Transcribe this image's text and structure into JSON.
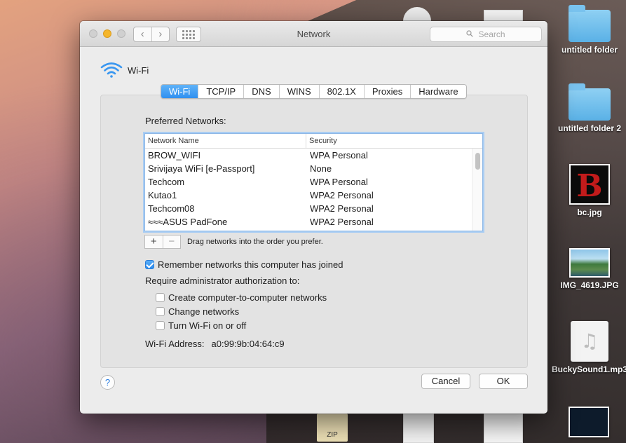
{
  "desktop": {
    "icons": [
      {
        "name": "untitled folder",
        "type": "folder"
      },
      {
        "name": "untitled folder 2",
        "type": "folder"
      },
      {
        "name": "bc.jpg",
        "type": "image"
      },
      {
        "name": "IMG_4619.JPG",
        "type": "image"
      },
      {
        "name": "BuckySound1.mp3",
        "type": "audio"
      }
    ],
    "zip_label": "ZIP"
  },
  "window": {
    "title": "Network",
    "search_placeholder": "Search"
  },
  "header": {
    "title": "Wi-Fi"
  },
  "tabs": [
    {
      "label": "Wi-Fi",
      "active": true
    },
    {
      "label": "TCP/IP",
      "active": false
    },
    {
      "label": "DNS",
      "active": false
    },
    {
      "label": "WINS",
      "active": false
    },
    {
      "label": "802.1X",
      "active": false
    },
    {
      "label": "Proxies",
      "active": false
    },
    {
      "label": "Hardware",
      "active": false
    }
  ],
  "preferred": {
    "label": "Preferred Networks:",
    "columns": {
      "name": "Network Name",
      "security": "Security"
    },
    "rows": [
      {
        "name": "BROW_WIFI",
        "security": "WPA Personal"
      },
      {
        "name": "Srivijaya WiFi [e-Passport]",
        "security": "None"
      },
      {
        "name": "Techcom",
        "security": "WPA Personal"
      },
      {
        "name": "Kutao1",
        "security": "WPA2 Personal"
      },
      {
        "name": "Techcom08",
        "security": "WPA2 Personal"
      },
      {
        "name": "≈≈≈ASUS PadFone",
        "security": "WPA2 Personal"
      }
    ],
    "add": "+",
    "remove": "−",
    "drag_hint": "Drag networks into the order you prefer."
  },
  "options": {
    "remember": {
      "label": "Remember networks this computer has joined",
      "checked": true
    },
    "require_label": "Require administrator authorization to:",
    "admin": [
      {
        "label": "Create computer-to-computer networks",
        "checked": false
      },
      {
        "label": "Change networks",
        "checked": false
      },
      {
        "label": "Turn Wi-Fi on or off",
        "checked": false
      }
    ]
  },
  "address": {
    "label": "Wi-Fi Address:",
    "value": "a0:99:9b:04:64:c9"
  },
  "buttons": {
    "help": "?",
    "cancel": "Cancel",
    "ok": "OK"
  },
  "colors": {
    "accent": "#2f8ff0",
    "wifi_icon": "#3a97f0"
  }
}
